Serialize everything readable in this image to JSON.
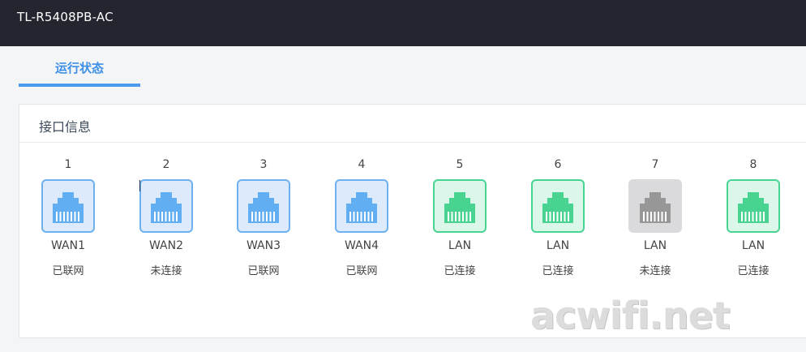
{
  "header": {
    "title": "TL-R5408PB-AC"
  },
  "tabs": [
    {
      "label": "运行状态"
    }
  ],
  "panel": {
    "title": "接口信息"
  },
  "ports": [
    {
      "number": "1",
      "type": "WAN1",
      "status": "已联网",
      "color": "blue"
    },
    {
      "number": "2",
      "type": "WAN2",
      "status": "未连接",
      "color": "blue"
    },
    {
      "number": "3",
      "type": "WAN3",
      "status": "已联网",
      "color": "blue"
    },
    {
      "number": "4",
      "type": "WAN4",
      "status": "已联网",
      "color": "blue"
    },
    {
      "number": "5",
      "type": "LAN",
      "status": "已连接",
      "color": "green"
    },
    {
      "number": "6",
      "type": "LAN",
      "status": "已连接",
      "color": "green"
    },
    {
      "number": "7",
      "type": "LAN",
      "status": "未连接",
      "color": "gray"
    },
    {
      "number": "8",
      "type": "LAN",
      "status": "已连接",
      "color": "green"
    }
  ],
  "icons": {
    "port": "ethernet-port-icon"
  },
  "colors": {
    "wan": "#62aef2",
    "lan": "#49d391",
    "disconnected": "#979797",
    "accent": "#4c9bea"
  },
  "watermark": "acwifi.net"
}
